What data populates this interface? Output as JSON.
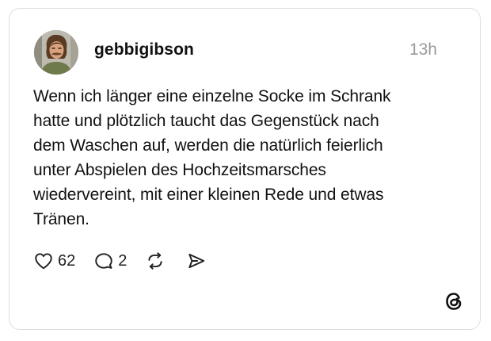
{
  "post": {
    "username": "gebbigibson",
    "timestamp": "13h",
    "text": "Wenn ich länger eine einzelne Socke im Schrank\nhatte und plötzlich taucht das Gegenstück nach\ndem Waschen auf, werden die natürlich feierlich\nunter Abspielen des Hochzeitsmarsches\nwiedervereint, mit einer kleinen Rede und etwas\nTränen.",
    "likes": "62",
    "replies": "2"
  },
  "icons": {
    "like": "heart-icon",
    "reply": "speech-bubble-icon",
    "repost": "repost-icon",
    "share": "send-icon",
    "brand": "threads-logo-icon"
  },
  "colors": {
    "text": "#111111",
    "muted": "#9a9a9a",
    "border": "#dedede",
    "background": "#ffffff"
  }
}
